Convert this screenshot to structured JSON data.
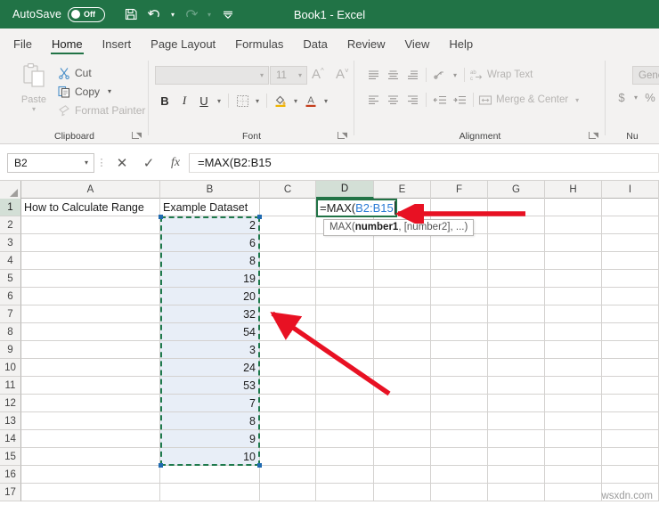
{
  "titlebar": {
    "autosave_label": "AutoSave",
    "autosave_state": "Off",
    "document_title": "Book1  -  Excel",
    "quick_access": [
      {
        "name": "save-icon",
        "label": "Save"
      },
      {
        "name": "undo-icon",
        "label": "Undo"
      },
      {
        "name": "redo-icon",
        "label": "Redo"
      },
      {
        "name": "customize-qat-icon",
        "label": "Customize Quick Access Toolbar"
      }
    ],
    "brand_color": "#217346"
  },
  "tabs": [
    {
      "label": "File",
      "active": false
    },
    {
      "label": "Home",
      "active": true
    },
    {
      "label": "Insert",
      "active": false
    },
    {
      "label": "Page Layout",
      "active": false
    },
    {
      "label": "Formulas",
      "active": false
    },
    {
      "label": "Data",
      "active": false
    },
    {
      "label": "Review",
      "active": false
    },
    {
      "label": "View",
      "active": false
    },
    {
      "label": "Help",
      "active": false
    }
  ],
  "ribbon": {
    "clipboard": {
      "group_label": "Clipboard",
      "paste_label": "Paste",
      "cut_label": "Cut",
      "copy_label": "Copy",
      "format_painter_label": "Format Painter"
    },
    "font": {
      "group_label": "Font",
      "font_name_value": "",
      "font_size_value": "11",
      "bold_label": "B",
      "italic_label": "I",
      "underline_label": "U",
      "grow_font_label": "A",
      "shrink_font_label": "A"
    },
    "alignment": {
      "group_label": "Alignment",
      "wrap_text_label": "Wrap Text",
      "merge_center_label": "Merge & Center"
    },
    "number": {
      "group_label": "Nu",
      "format_value": "General",
      "currency_label": "$",
      "percent_label": "%"
    }
  },
  "formula_bar": {
    "name_box_value": "B2",
    "cancel_label": "✕",
    "enter_label": "✓",
    "insert_function_label": "fx",
    "formula_value": "=MAX(B2:B15"
  },
  "grid": {
    "columns": [
      "A",
      "B",
      "C",
      "D",
      "E",
      "F",
      "G",
      "H",
      "I"
    ],
    "active_column": "D",
    "rows": [
      "1",
      "2",
      "3",
      "4",
      "5",
      "6",
      "7",
      "8",
      "9",
      "10",
      "11",
      "12",
      "13",
      "14",
      "15",
      "16",
      "17"
    ],
    "active_row": "1",
    "cells": {
      "A1": "How to Calculate Range",
      "B1": "Example Dataset"
    },
    "dataset_column": "B",
    "dataset_values": [
      "2",
      "6",
      "8",
      "19",
      "20",
      "32",
      "54",
      "3",
      "24",
      "53",
      "7",
      "8",
      "9",
      "10"
    ],
    "dataset_range_label": "B2:B15",
    "edit_cell": {
      "address": "D1",
      "prefix": "=MAX(",
      "reference": "B2:B15",
      "reference_color": "#2b7bd4"
    },
    "tooltip": {
      "func": "MAX(",
      "arg1": "number1",
      "rest": ", [number2], ...)"
    }
  },
  "annotations": {
    "arrow_color": "#e81123",
    "arrow_formula_label": "points to formula being typed",
    "arrow_range_label": "points to selected dataset range"
  },
  "watermark": "wsxdn.com"
}
